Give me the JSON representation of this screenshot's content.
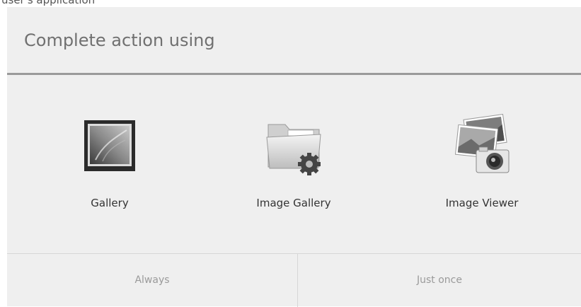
{
  "top_text": "user's application",
  "dialog": {
    "title": "Complete action using",
    "apps": [
      {
        "label": "Gallery",
        "icon": "gallery-icon"
      },
      {
        "label": "Image Gallery",
        "icon": "folder-gear-icon"
      },
      {
        "label": "Image Viewer",
        "icon": "photos-camera-icon"
      }
    ],
    "buttons": {
      "always": "Always",
      "just_once": "Just once"
    }
  }
}
